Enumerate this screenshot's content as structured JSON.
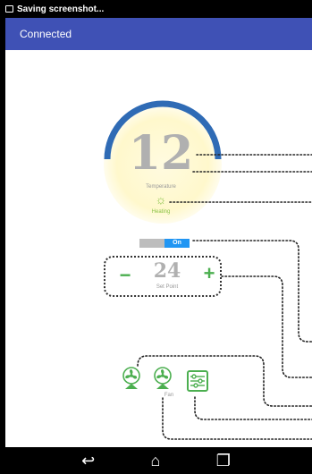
{
  "status_bar": {
    "text": "Saving screenshot..."
  },
  "app_bar": {
    "title": "Connected"
  },
  "thermostat": {
    "temperature": "12",
    "temperature_label": "Temperature",
    "mode_label": "Heating",
    "gauge_fill_fraction": 0.5
  },
  "toggle": {
    "label": "On",
    "state": "on"
  },
  "set_point": {
    "value": "24",
    "label": "Set Point",
    "minus": "−",
    "plus": "+"
  },
  "bottom": {
    "fan_label": "Fan"
  },
  "colors": {
    "app_bar": "#3f51b5",
    "gauge_arc": "#2f6bb5",
    "accent_green": "#4caf50",
    "toggle_on": "#2196f3"
  },
  "icons": [
    "screenshot-icon",
    "sun-icon",
    "fan-icon",
    "settings-sliders-icon",
    "back-icon",
    "home-icon",
    "recents-icon"
  ]
}
